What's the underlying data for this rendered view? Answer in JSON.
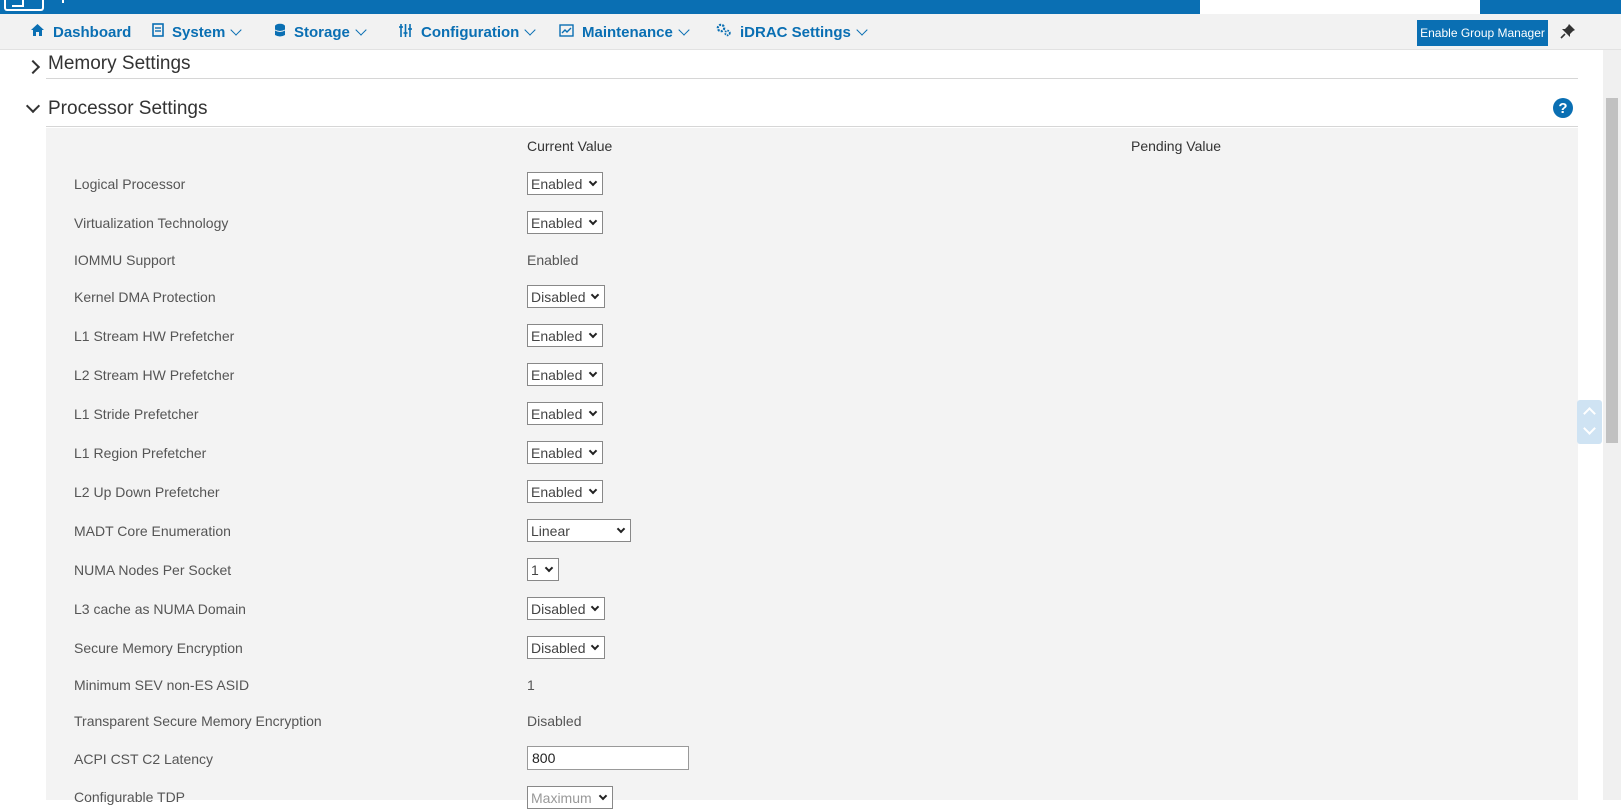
{
  "nav": {
    "items": [
      {
        "label": "Dashboard",
        "icon": "home-icon"
      },
      {
        "label": "System",
        "icon": "server-icon"
      },
      {
        "label": "Storage",
        "icon": "database-icon"
      },
      {
        "label": "Configuration",
        "icon": "sliders-icon"
      },
      {
        "label": "Maintenance",
        "icon": "chart-icon"
      },
      {
        "label": "iDRAC Settings",
        "icon": "gears-icon"
      }
    ],
    "group_manager_button": "Enable Group Manager"
  },
  "sections": {
    "memory": {
      "title": "Memory Settings"
    },
    "processor": {
      "title": "Processor Settings"
    }
  },
  "table": {
    "current_header": "Current Value",
    "pending_header": "Pending Value",
    "rows": [
      {
        "label": "Logical Processor",
        "value": "Enabled"
      },
      {
        "label": "Virtualization Technology",
        "value": "Enabled"
      },
      {
        "label": "IOMMU Support",
        "value": "Enabled"
      },
      {
        "label": "Kernel DMA Protection",
        "value": "Disabled"
      },
      {
        "label": "L1 Stream HW Prefetcher",
        "value": "Enabled"
      },
      {
        "label": "L2 Stream HW Prefetcher",
        "value": "Enabled"
      },
      {
        "label": "L1 Stride Prefetcher",
        "value": "Enabled"
      },
      {
        "label": "L1 Region Prefetcher",
        "value": "Enabled"
      },
      {
        "label": "L2 Up Down Prefetcher",
        "value": "Enabled"
      },
      {
        "label": "MADT Core Enumeration",
        "value": "Linear"
      },
      {
        "label": "NUMA Nodes Per Socket",
        "value": "1"
      },
      {
        "label": "L3 cache as NUMA Domain",
        "value": "Disabled"
      },
      {
        "label": "Secure Memory Encryption",
        "value": "Disabled"
      },
      {
        "label": "Minimum SEV non-ES ASID",
        "value": "1"
      },
      {
        "label": "Transparent Secure Memory Encryption",
        "value": "Disabled"
      },
      {
        "label": "ACPI CST C2 Latency",
        "value": "800"
      },
      {
        "label": "Configurable TDP",
        "value": "Maximum"
      }
    ]
  },
  "colors": {
    "accent": "#0a6fb3",
    "panel": "#f3f3f3"
  }
}
